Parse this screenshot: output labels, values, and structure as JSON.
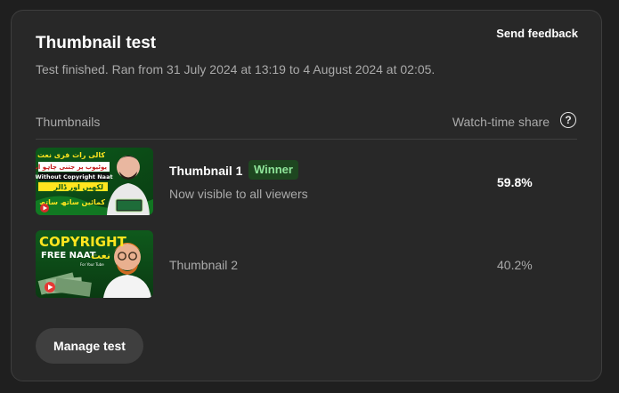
{
  "card": {
    "title": "Thumbnail test",
    "feedback_label": "Send feedback",
    "subtitle": "Test finished. Ran from 31 July 2024 at 13:19 to 4 August 2024 at 02:05."
  },
  "table": {
    "header_left": "Thumbnails",
    "header_right": "Watch-time share",
    "help_icon": "?",
    "rows": [
      {
        "name": "Thumbnail 1",
        "badge": "Winner",
        "status": "Now visible to all viewers",
        "share": "59.8%",
        "thumb": {
          "line1": "کالی رات فری نعت رسول ﷺ",
          "line2": "یوٹیوب پر جتنی چاہو اپلوڈ کرو",
          "line3": "Without Copyright Naat",
          "line4": "لکھیں اور ڈالر",
          "line5": "کمائیں ساتھ ساتھ"
        }
      },
      {
        "name": "Thumbnail 2",
        "status": "",
        "share": "40.2%",
        "thumb": {
          "line1": "COPYRIGHT",
          "line2": "FREE NAAT",
          "line3": "نعت",
          "line4": "For Your Tube"
        }
      }
    ]
  },
  "manage_label": "Manage test",
  "colors": {
    "background": "#1f1f1f",
    "card": "#282828",
    "badge_bg": "#1e4620",
    "badge_text": "#8fe59a"
  }
}
